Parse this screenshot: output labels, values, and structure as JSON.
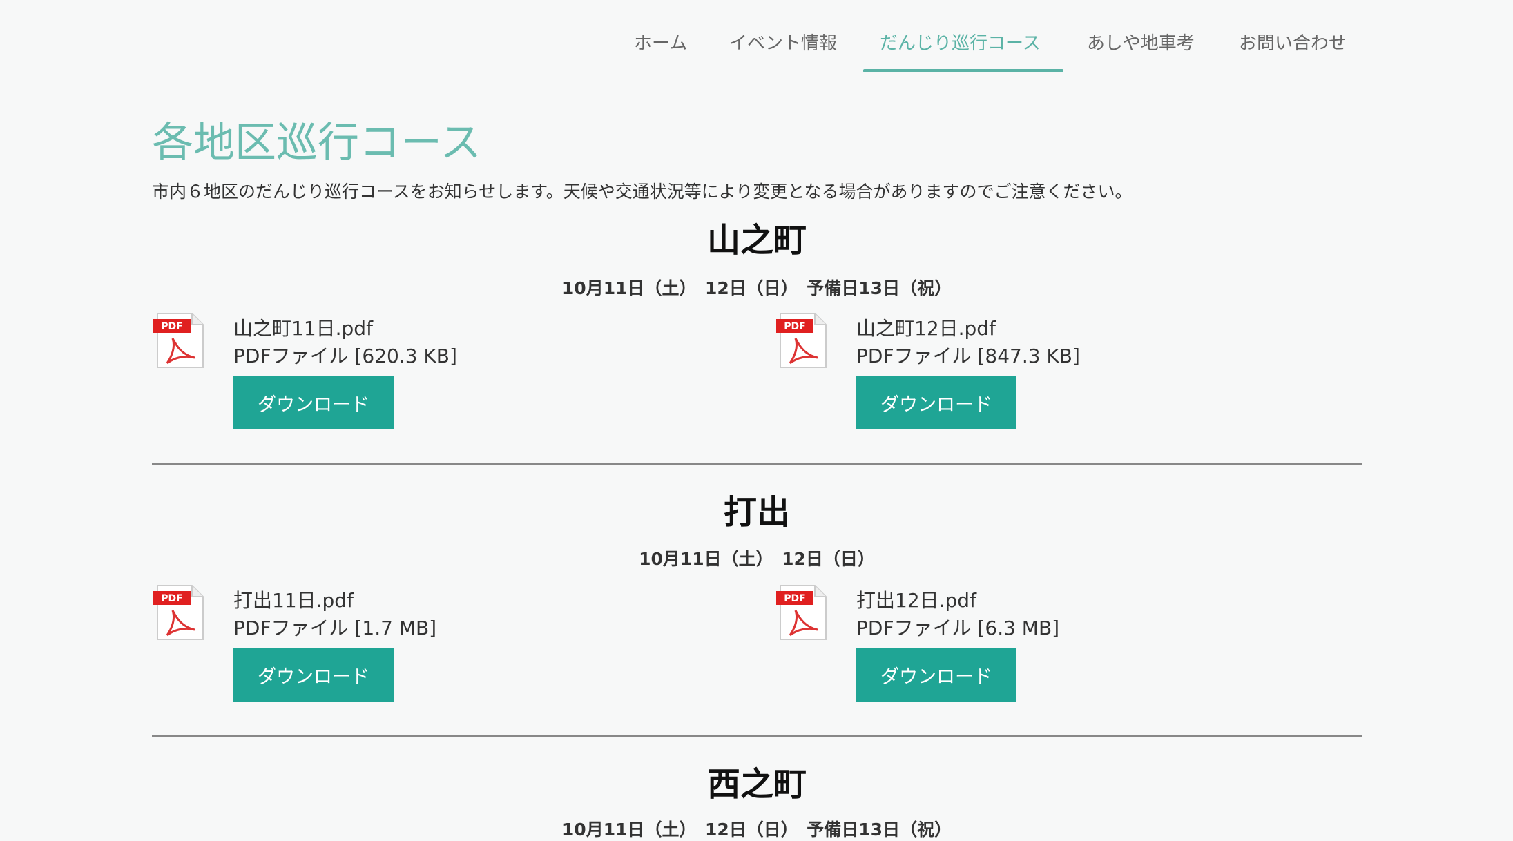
{
  "nav": {
    "items": [
      {
        "label": "ホーム"
      },
      {
        "label": "イベント情報"
      },
      {
        "label": "だんじり巡行コース"
      },
      {
        "label": "あしや地車考"
      },
      {
        "label": "お問い合わせ"
      }
    ],
    "active_index": 2
  },
  "page": {
    "title": "各地区巡行コース",
    "intro": "市内６地区のだんじり巡行コースをお知らせします。天候や交通状況等により変更となる場合がありますのでご注意ください。"
  },
  "sections": [
    {
      "name": "山之町",
      "dates": "10月11日（土）　12日（日）　予備日13日（祝）",
      "files": [
        {
          "name": "山之町11日.pdf",
          "meta": "PDFファイル [620.3 KB]",
          "button": "ダウンロード"
        },
        {
          "name": "山之町12日.pdf",
          "meta": "PDFファイル [847.3 KB]",
          "button": "ダウンロード"
        }
      ]
    },
    {
      "name": "打出",
      "dates": "10月11日（土）　12日（日）",
      "files": [
        {
          "name": "打出11日.pdf",
          "meta": "PDFファイル [1.7 MB]",
          "button": "ダウンロード"
        },
        {
          "name": "打出12日.pdf",
          "meta": "PDFファイル [6.3 MB]",
          "button": "ダウンロード"
        }
      ]
    },
    {
      "name": "西之町",
      "dates": "10月11日（土）　12日（日）　予備日13日（祝）"
    }
  ],
  "icons": {
    "pdf": "pdf-file-icon",
    "pdf_badge": "PDF"
  },
  "colors": {
    "accent": "#5bb3a6",
    "button": "#1fa595",
    "divider": "#888888"
  }
}
